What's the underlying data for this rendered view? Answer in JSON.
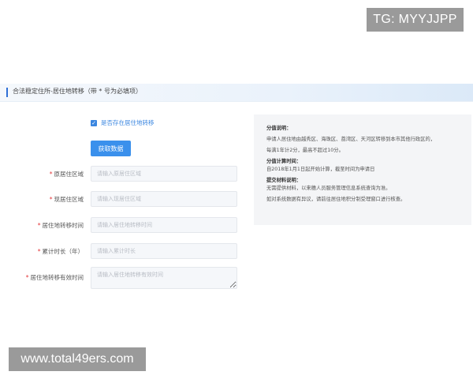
{
  "watermarks": {
    "top_right": "TG: MYYJJPP",
    "bottom_left": "www.total49ers.com"
  },
  "section": {
    "title": "合法稳定住所-居住地转移（带 * 号为必填项）"
  },
  "checkbox": {
    "label": "是否存在居住地转移",
    "checked": true
  },
  "fetch_button": {
    "label": "获取数据"
  },
  "form": {
    "fields": [
      {
        "label": "原居住区域",
        "required": true,
        "placeholder": "请输入原居住区域",
        "value": ""
      },
      {
        "label": "现居住区域",
        "required": true,
        "placeholder": "请输入现居住区域",
        "value": ""
      },
      {
        "label": "居住地转移时间",
        "required": true,
        "placeholder": "请输入居住地转移时间",
        "value": ""
      },
      {
        "label": "累计时长（年）",
        "required": true,
        "placeholder": "请输入累计时长",
        "value": ""
      },
      {
        "label": "居住地转移有效时间",
        "required": true,
        "placeholder": "请输入居住地转移有效时间",
        "value": ""
      }
    ]
  },
  "info": {
    "score_heading": "分值说明：",
    "score_line1": "申请人居住地由越秀区、海珠区、荔湾区、天河区转移到本市其他行政区的，",
    "score_line2": "每满1年计2分，最高不超过10分。",
    "calc_heading": "分值计算时间：",
    "calc_line": "自2018年1月1日起开始计算，截至时间为申请日",
    "material_heading": "提交材料说明：",
    "material_line": "无需提供材料，以来穗人员服务管理信息系统查询为准。",
    "objection_line": "如对系统数据有异议，请前往居住地积分制受理窗口进行核查。"
  },
  "colors": {
    "accent": "#3a90ec",
    "required": "#e4393c",
    "panel_bg": "#f4f5f7",
    "header_bar": "#2f6fd6"
  }
}
